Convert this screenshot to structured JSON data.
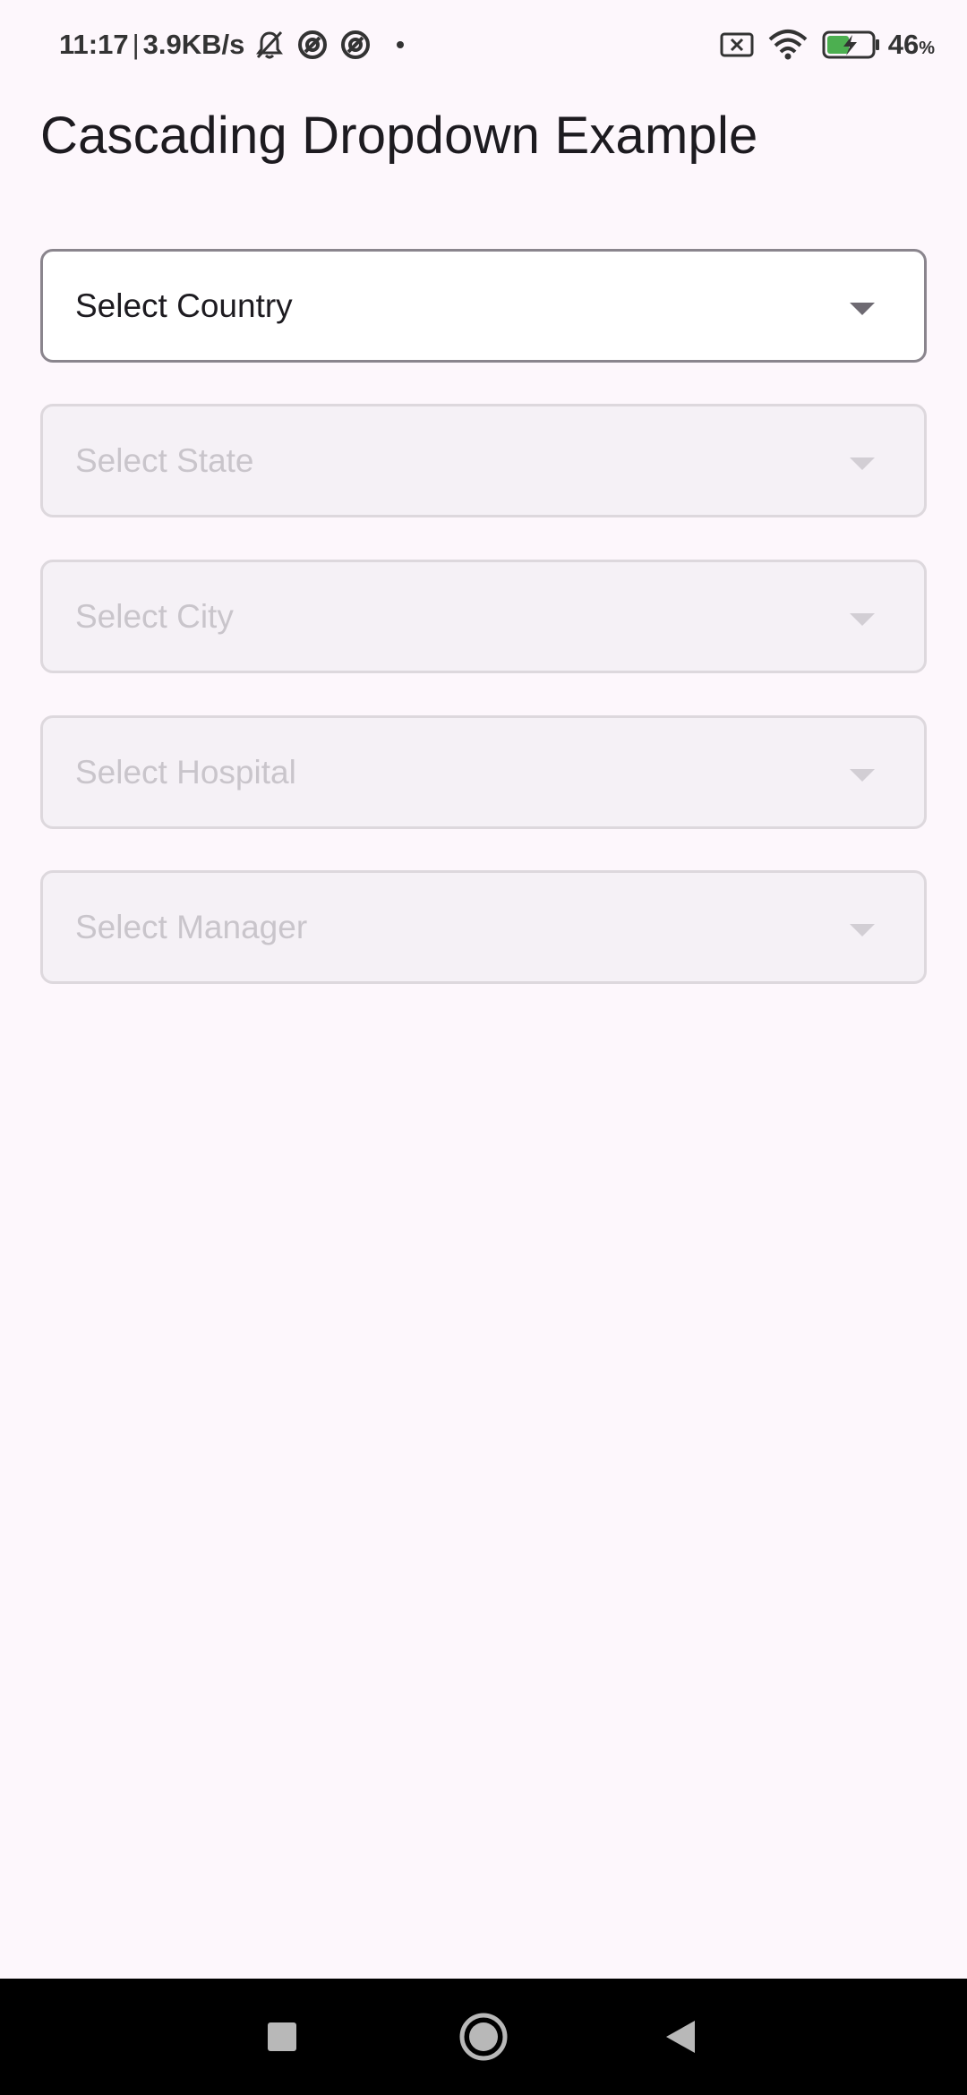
{
  "status_bar": {
    "time": "11:17",
    "separator": "|",
    "network_speed": "3.9KB/s",
    "icons_left": [
      "bell-muted-icon",
      "sync-circle-icon",
      "sync-circle-icon",
      "dot-icon"
    ],
    "icons_right": [
      "sim-x-icon",
      "wifi-icon",
      "battery-charging-icon"
    ],
    "battery_percent": "46",
    "battery_unit": "%"
  },
  "page": {
    "title": "Cascading Dropdown Example"
  },
  "dropdowns": [
    {
      "label": "Select Country",
      "enabled": true
    },
    {
      "label": "Select State",
      "enabled": false
    },
    {
      "label": "Select City",
      "enabled": false
    },
    {
      "label": "Select Hospital",
      "enabled": false
    },
    {
      "label": "Select Manager",
      "enabled": false
    }
  ],
  "nav_bar": {
    "buttons": [
      "recents-square-icon",
      "home-circle-icon",
      "back-triangle-icon"
    ]
  },
  "colors": {
    "background": "#fdf7fc",
    "enabled_border": "#8a858d",
    "disabled_border": "#ddd8dd",
    "disabled_fill": "#f5f1f6",
    "disabled_text": "#c9c5cb",
    "battery_charge": "#4caf50",
    "nav_bar": "#000000"
  }
}
